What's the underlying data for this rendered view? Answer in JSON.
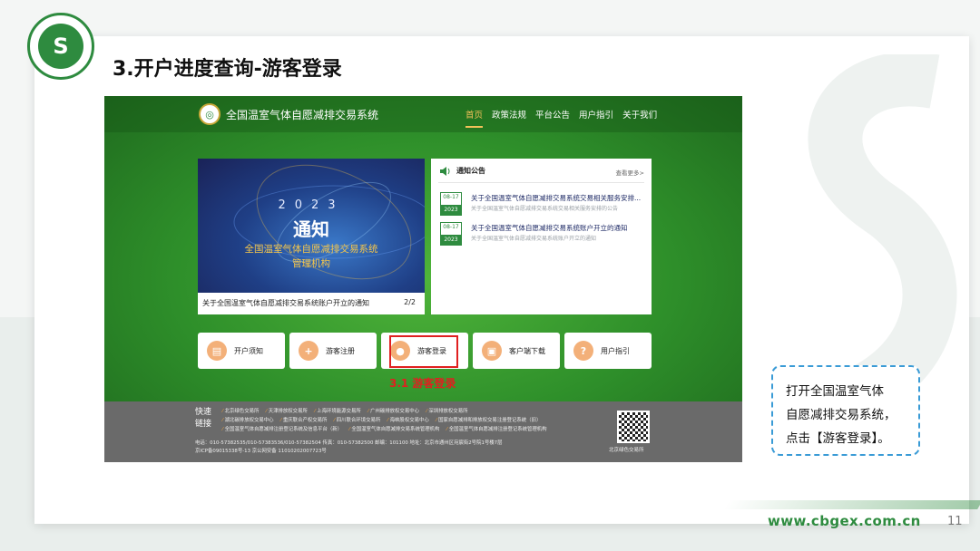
{
  "slide": {
    "title": "3.开户进度查询-游客登录",
    "url": "www.cbgex.com.cn",
    "page_number": "11"
  },
  "colors": {
    "brand_green": "#2e8b3f",
    "highlight_red": "#e02020",
    "callout_border": "#3a9bd6",
    "nav_active": "#f2c15a"
  },
  "site": {
    "title": "全国温室气体自愿减排交易系统",
    "nav": [
      "首页",
      "政策法规",
      "平台公告",
      "用户指引",
      "关于我们"
    ],
    "nav_active": "首页"
  },
  "banner": {
    "year": "2023",
    "title": "通知",
    "subtitle_line1": "全国温室气体自愿减排交易系统",
    "subtitle_line2": "管理机构",
    "caption": "关于全国温室气体自愿减排交易系统账户开立的通知",
    "pager": "2/2"
  },
  "notices": {
    "title": "通知公告",
    "more": "查看更多>",
    "items": [
      {
        "date": "08-17",
        "year": "2023",
        "title": "关于全国温室气体自愿减排交易系统交易相关服务安排...",
        "summary": "关于全国温室气体自愿减排交易系统交易相关服务安排的公告"
      },
      {
        "date": "08-17",
        "year": "2023",
        "title": "关于全国温室气体自愿减排交易系统账户开立的通知",
        "summary": "关于全国温室气体自愿减排交易系统账户开立的通知"
      }
    ]
  },
  "quick_buttons": [
    {
      "label": "开户须知",
      "icon": "document-icon"
    },
    {
      "label": "游客注册",
      "icon": "user-add-icon"
    },
    {
      "label": "游客登录",
      "icon": "users-icon"
    },
    {
      "label": "客户端下载",
      "icon": "download-icon"
    },
    {
      "label": "用户指引",
      "icon": "question-icon"
    }
  ],
  "step_label": "3.1 游客登录",
  "footer": {
    "heading_line1": "快速",
    "heading_line2": "链接",
    "links": [
      "北京绿色交易所",
      "天津排放权交易所",
      "上海环境能源交易所",
      "广州碳排放权交易中心",
      "深圳排放权交易所",
      "湖北碳排放权交易中心",
      "重庆联合产权交易所",
      "四川联合环境交易所",
      "海峡股权交易中心",
      "国家自愿减排和排放权交易注册登记系统（旧）",
      "全国温室气体自愿减排注册登记系统及信息平台（新）",
      "全国温室气体自愿减排交易系统管理机构",
      "全国温室气体自愿减排注册登记系统管理机构"
    ],
    "contact_line1": "电话：010-57382535/010-57383536/010-57382504    传真：010-57382500    邮编：101100    地址：北京市通州区宛宸街2号院1号楼7层",
    "contact_line2": "京ICP备09015338号-13    京公网安备 11010202007723号",
    "qr_label": "北京绿色交易所"
  },
  "callout": {
    "line1": "打开全国温室气体",
    "line2": "自愿减排交易系统，",
    "line3": "点击【游客登录】。"
  }
}
